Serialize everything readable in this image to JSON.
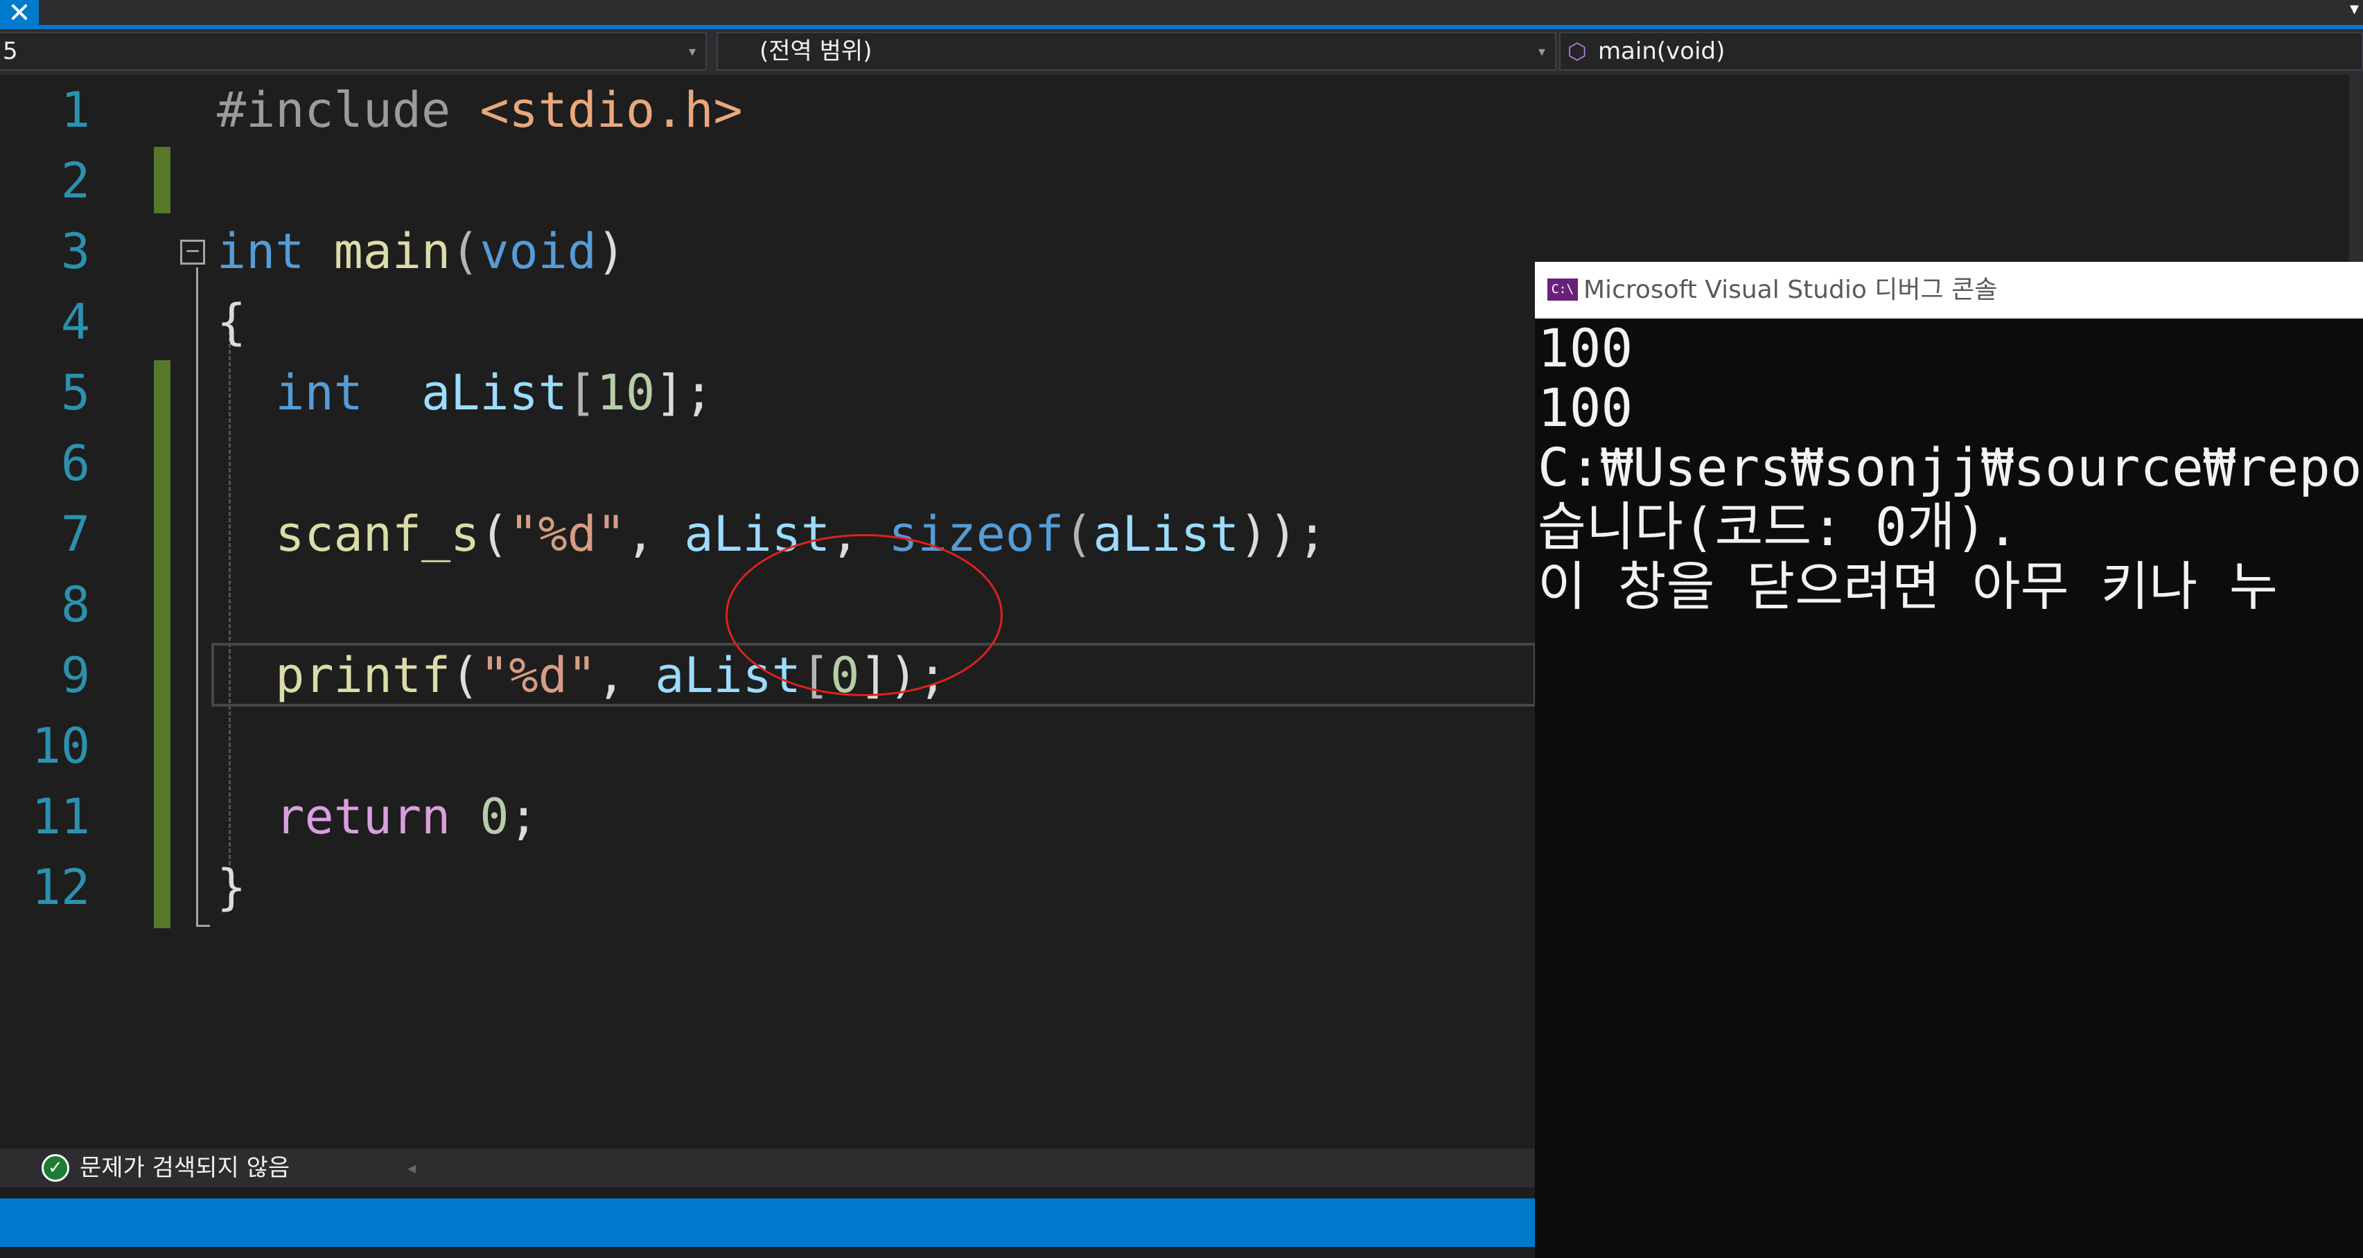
{
  "tabs": {
    "close_glyph": "✕",
    "overflow_glyph": "▾"
  },
  "nav": {
    "project_fragment": "5",
    "scope": "(전역 범위)",
    "member": "main(void)",
    "arrow_glyph": "▾",
    "member_icon": "cube-icon"
  },
  "editor": {
    "line_numbers": [
      "1",
      "2",
      "3",
      "4",
      "5",
      "6",
      "7",
      "8",
      "9",
      "10",
      "11",
      "12"
    ],
    "outline_glyph": "−",
    "code": {
      "l1_directive": "#include",
      "l1_header": "<stdio.h>",
      "l3_type": "int",
      "l3_func": "main",
      "l3_open": "(",
      "l3_param": "void",
      "l3_close": ")",
      "l4": "{",
      "l5_type": "int",
      "l5_var": "aList",
      "l5_open": "[",
      "l5_size": "10",
      "l5_close": "];",
      "l7_func": "scanf_s",
      "l7_open": "(",
      "l7_fmt": "\"%d\"",
      "l7_sep1": ", ",
      "l7_arg": "aList",
      "l7_sep2": ", ",
      "l7_sizeof": "sizeof",
      "l7_open2": "(",
      "l7_arg2": "aList",
      "l7_close": "));",
      "l9_func": "printf",
      "l9_open": "(",
      "l9_fmt": "\"%d\"",
      "l9_sep": ", ",
      "l9_arg": "aList",
      "l9_open2": "[",
      "l9_idx": "0",
      "l9_close": "]);",
      "l11_kw": "return",
      "l11_val": "0",
      "l11_end": ";",
      "l12": "}"
    },
    "colors": {
      "line_number": "#2b91af",
      "keyword": "#569cd6",
      "function": "#dcdcaa",
      "variable": "#9cdcfe",
      "string": "#d69d85",
      "number": "#b5cea8",
      "control": "#d8a0df",
      "change_marker": "#57772b",
      "annotation_circle": "#e02020"
    }
  },
  "status": {
    "issues_icon": "check-circle-icon",
    "issues_glyph": "✓",
    "issues_text": "문제가 검색되지 않음",
    "scroll_glyph": "◂",
    "accent": "#007acc"
  },
  "console": {
    "icon_text": "C:\\",
    "title": "Microsoft Visual Studio 디버그 콘솔",
    "lines": [
      "100",
      "100",
      "C:₩Users₩sonjj₩source₩repos₩P",
      "습니다(코드: 0개).",
      "이 창을 닫으려면 아무 키나 누"
    ]
  }
}
